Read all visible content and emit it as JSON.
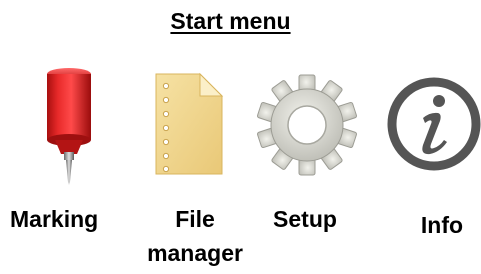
{
  "menu": {
    "title": "Start menu",
    "items": [
      {
        "id": "marking",
        "label": "Marking",
        "icon": "marking-pen-icon"
      },
      {
        "id": "file-manager",
        "label_line1": "File",
        "label_line2": "manager",
        "icon": "file-document-icon"
      },
      {
        "id": "setup",
        "label": "Setup",
        "icon": "gear-icon"
      },
      {
        "id": "info",
        "label": "Info",
        "icon": "info-icon"
      }
    ]
  },
  "colors": {
    "marking_red": "#d81f1f",
    "file_paper": "#f2d892",
    "gear_gray": "#d8d8d0",
    "info_gray": "#555555"
  }
}
